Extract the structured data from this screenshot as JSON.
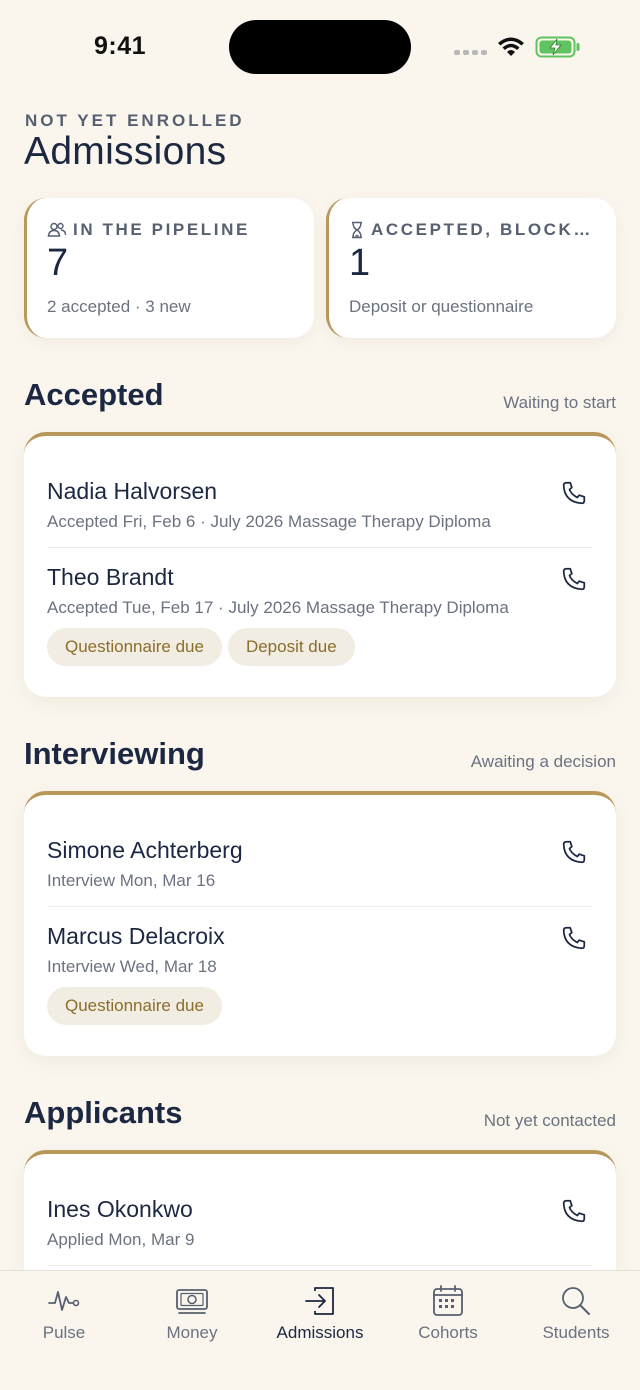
{
  "status": {
    "time": "9:41"
  },
  "header": {
    "eyebrow": "NOT YET ENROLLED",
    "title": "Admissions"
  },
  "stats": [
    {
      "label": "IN THE PIPELINE",
      "value": "7",
      "sub": "2 accepted · 3 new",
      "icon": "people-icon"
    },
    {
      "label": "ACCEPTED, BLOCK…",
      "value": "1",
      "sub": "Deposit or questionnaire",
      "icon": "hourglass-icon"
    }
  ],
  "sections": {
    "accepted": {
      "title": "Accepted",
      "note": "Waiting to start",
      "rows": [
        {
          "name": "Nadia Halvorsen",
          "meta": "Accepted Fri, Feb 6 · July 2026 Massage Therapy Diploma",
          "tags": []
        },
        {
          "name": "Theo Brandt",
          "meta": "Accepted Tue, Feb 17 · July 2026 Massage Therapy Diploma",
          "tags": [
            "Questionnaire due",
            "Deposit due"
          ]
        }
      ]
    },
    "interviewing": {
      "title": "Interviewing",
      "note": "Awaiting a decision",
      "rows": [
        {
          "name": "Simone Achterberg",
          "meta": "Interview Mon, Mar 16",
          "tags": []
        },
        {
          "name": "Marcus Delacroix",
          "meta": "Interview Wed, Mar 18",
          "tags": [
            "Questionnaire due"
          ]
        }
      ]
    },
    "applicants": {
      "title": "Applicants",
      "note": "Not yet contacted",
      "rows": [
        {
          "name": "Ines Okonkwo",
          "meta": "Applied Mon, Mar 9",
          "tags": []
        }
      ]
    }
  },
  "tabbar": {
    "active": "Admissions",
    "items": [
      {
        "label": "Pulse",
        "icon": "pulse-icon"
      },
      {
        "label": "Money",
        "icon": "money-icon"
      },
      {
        "label": "Admissions",
        "icon": "admissions-icon"
      },
      {
        "label": "Cohorts",
        "icon": "calendar-icon"
      },
      {
        "label": "Students",
        "icon": "search-icon"
      }
    ]
  },
  "colors": {
    "accent": "#b8985a",
    "navy": "#1c2742",
    "background": "#faf6ee",
    "tag_bg": "#f2ede2",
    "tag_text": "#8b6d2c"
  }
}
